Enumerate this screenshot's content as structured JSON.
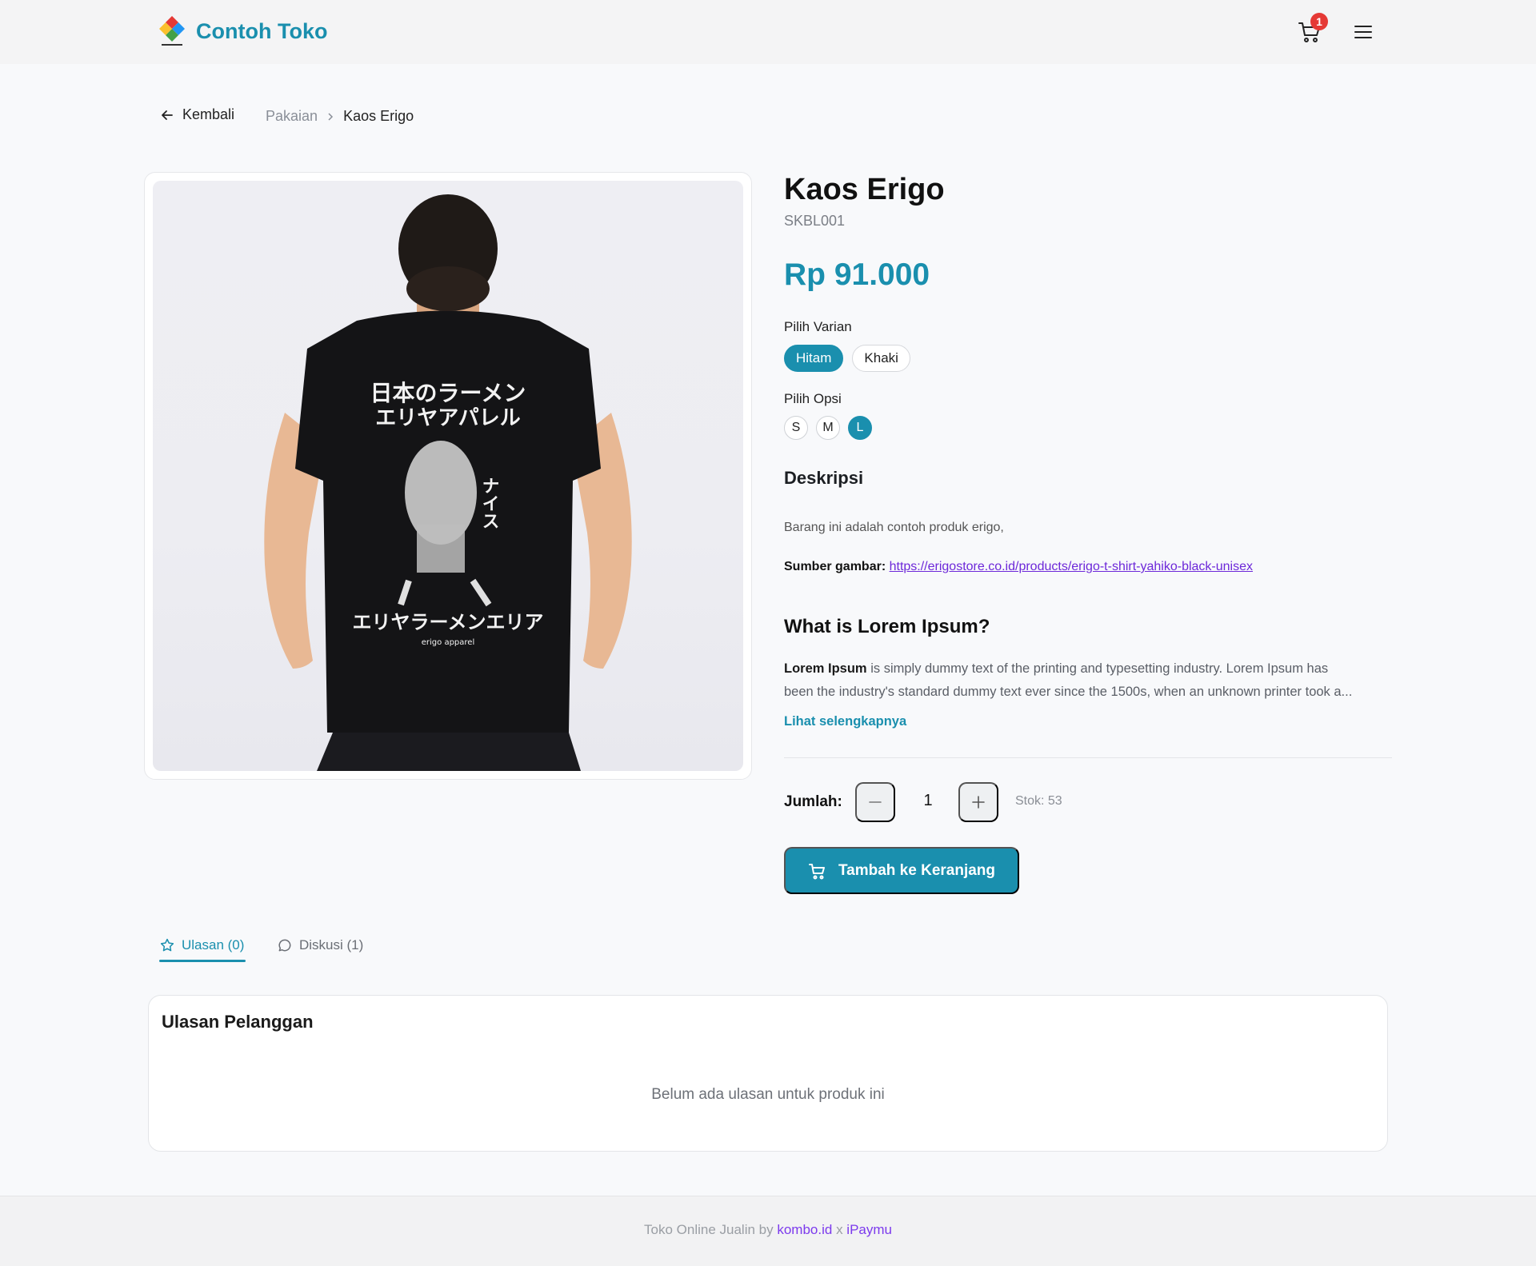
{
  "header": {
    "brand": "Contoh Toko",
    "cart_count": "1",
    "icons": {
      "logo": "logo-icon",
      "cart": "cart-icon",
      "menu": "menu-icon"
    }
  },
  "breadcrumb": {
    "back_label": "Kembali",
    "category": "Pakaian",
    "current": "Kaos Erigo"
  },
  "product": {
    "title": "Kaos Erigo",
    "sku": "SKBL001",
    "price": "Rp 91.000",
    "image_alt": "Kaos Erigo"
  },
  "variants": {
    "label": "Pilih Varian",
    "items": [
      {
        "label": "Hitam",
        "selected": true
      },
      {
        "label": "Khaki",
        "selected": false
      }
    ]
  },
  "options": {
    "label": "Pilih Opsi",
    "items": [
      {
        "label": "S",
        "selected": false
      },
      {
        "label": "M",
        "selected": false
      },
      {
        "label": "L",
        "selected": true
      }
    ]
  },
  "description": {
    "title": "Deskripsi",
    "text": "Barang ini adalah contoh produk erigo,",
    "source_label": "Sumber gambar:",
    "source_link": "https://erigostore.co.id/products/erigo-t-shirt-yahiko-black-unisex",
    "lorem_title": "What is Lorem Ipsum?",
    "lorem_bold": "Lorem Ipsum",
    "lorem_line1": " is simply dummy text of the printing and typesetting industry. Lorem Ipsum has",
    "lorem_line2": "been the industry's standard dummy text ever since the 1500s, when an unknown printer took a...",
    "more_link": "Lihat selengkapnya"
  },
  "quantity": {
    "label": "Jumlah:",
    "value": "1",
    "stock": "Stok: 53"
  },
  "add_to_cart": {
    "label": "Tambah ke Keranjang"
  },
  "tabs": [
    {
      "label": "Ulasan (0)",
      "active": true,
      "icon": "star-icon"
    },
    {
      "label": "Diskusi (1)",
      "active": false,
      "icon": "chat-icon"
    }
  ],
  "reviews": {
    "title": "Ulasan Pelanggan",
    "empty": "Belum ada ulasan untuk produk ini"
  },
  "footer": {
    "prefix": "Toko Online Jualin by",
    "link1": "kombo.id",
    "separator": "x",
    "link2": "iPaymu"
  },
  "colors": {
    "accent": "#1a8fae",
    "link": "#6d28d9",
    "badge": "#e53935"
  }
}
